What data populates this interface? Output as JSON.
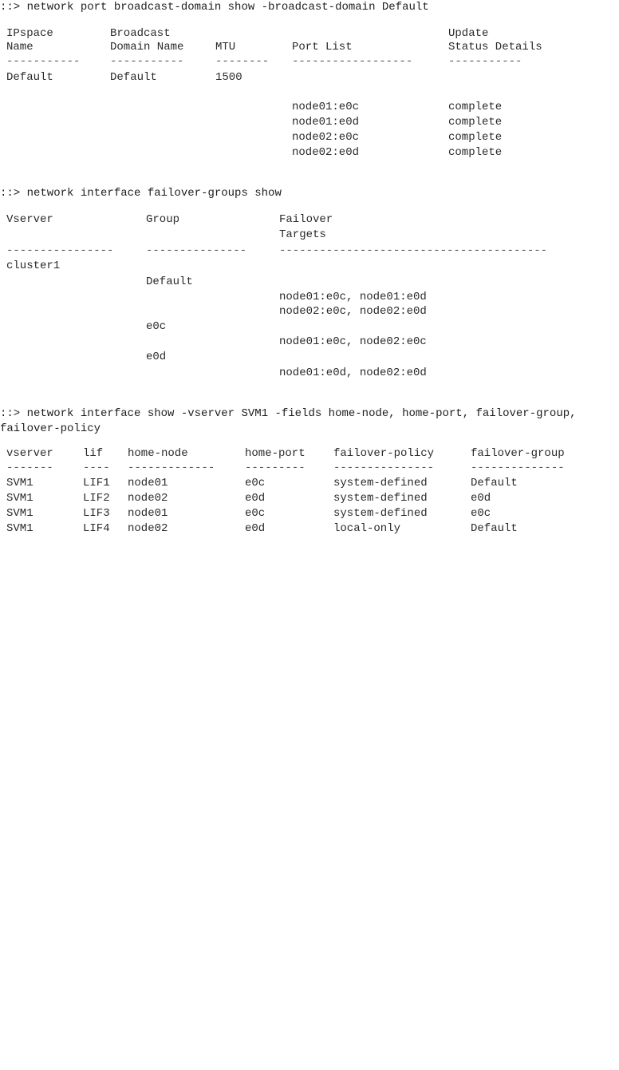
{
  "section1": {
    "command": "::> network port broadcast-domain show -broadcast-domain Default",
    "headers": {
      "ipspace": [
        "IPspace",
        "Name"
      ],
      "domain": [
        "Broadcast",
        "Domain Name"
      ],
      "mtu": [
        "",
        "MTU"
      ],
      "ports": [
        "",
        "Port List"
      ],
      "status": [
        "Update",
        "Status Details"
      ]
    },
    "dashes": [
      "-----------",
      "-----------",
      "--------",
      "------------------",
      "-----------"
    ],
    "row": {
      "ipspace": "Default",
      "domain": "Default",
      "mtu": "1500"
    },
    "ports": [
      {
        "port": "node01:e0c",
        "status": "complete"
      },
      {
        "port": "node01:e0d",
        "status": "complete"
      },
      {
        "port": "node02:e0c",
        "status": "complete"
      },
      {
        "port": "node02:e0d",
        "status": "complete"
      }
    ]
  },
  "section2": {
    "command": "::> network interface failover-groups show",
    "headers": {
      "vserver": "Vserver",
      "group": "Group",
      "targets": [
        "Failover",
        "Targets"
      ]
    },
    "dashes": [
      "----------------",
      "---------------",
      "----------------------------------------"
    ],
    "vserver": "cluster1",
    "groups": [
      {
        "name": "Default",
        "targets": [
          "node01:e0c, node01:e0d",
          "node02:e0c, node02:e0d"
        ]
      },
      {
        "name": "e0c",
        "targets": [
          "node01:e0c, node02:e0c"
        ]
      },
      {
        "name": "e0d",
        "targets": [
          "node01:e0d, node02:e0d"
        ]
      }
    ]
  },
  "section3": {
    "command": "::> network interface show -vserver SVM1 -fields home-node, home-port, failover-group, failover-policy",
    "headers": [
      "vserver",
      "lif",
      "home-node",
      "home-port",
      "failover-policy",
      "failover-group"
    ],
    "dashes": [
      "-------",
      "----",
      "-------------",
      "---------",
      "---------------",
      "--------------"
    ],
    "rows": [
      [
        "SVM1",
        "LIF1",
        "node01",
        "e0c",
        "system-defined",
        "Default"
      ],
      [
        "SVM1",
        "LIF2",
        "node02",
        "e0d",
        "system-defined",
        "e0d"
      ],
      [
        "SVM1",
        "LIF3",
        "node01",
        "e0c",
        "system-defined",
        "e0c"
      ],
      [
        "SVM1",
        "LIF4",
        "node02",
        "e0d",
        "local-only",
        "Default"
      ]
    ]
  }
}
